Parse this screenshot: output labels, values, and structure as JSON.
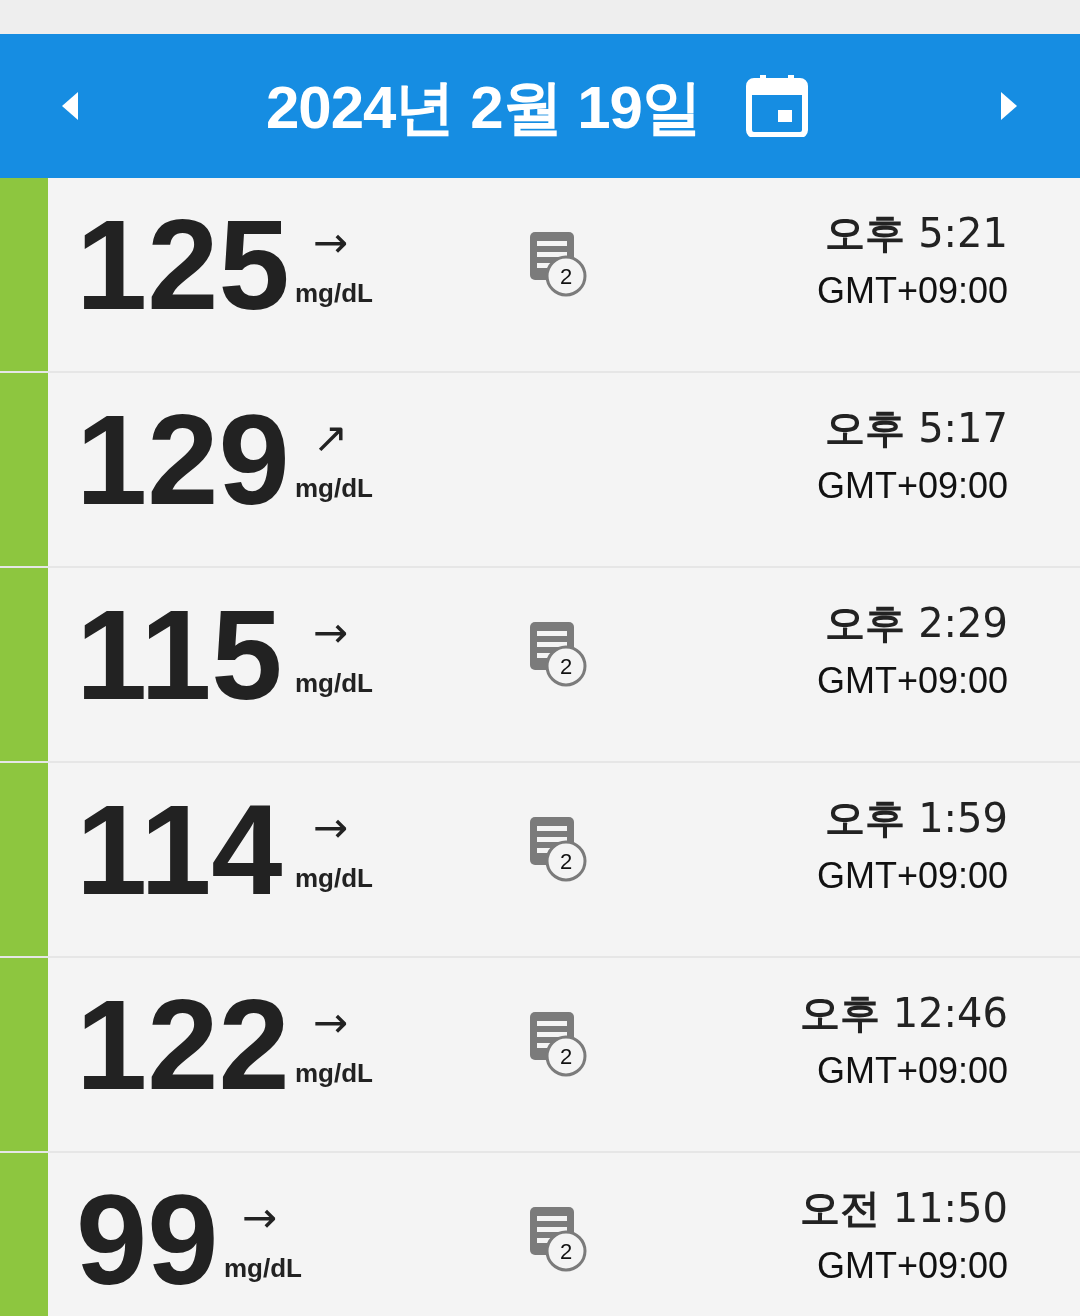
{
  "header": {
    "date": "2024년 2월 19일"
  },
  "readings": [
    {
      "value": "125",
      "unit": "mg/dL",
      "trend": "→",
      "color": "#8dc63f",
      "notes": "2",
      "period": "오후",
      "time": "5:21",
      "zone": "GMT+09:00"
    },
    {
      "value": "129",
      "unit": "mg/dL",
      "trend": "↗",
      "color": "#8dc63f",
      "period": "오후",
      "time": "5:17",
      "zone": "GMT+09:00"
    },
    {
      "value": "115",
      "unit": "mg/dL",
      "trend": "→",
      "color": "#8dc63f",
      "notes": "2",
      "period": "오후",
      "time": "2:29",
      "zone": "GMT+09:00"
    },
    {
      "value": "114",
      "unit": "mg/dL",
      "trend": "→",
      "color": "#8dc63f",
      "notes": "2",
      "period": "오후",
      "time": "1:59",
      "zone": "GMT+09:00"
    },
    {
      "value": "122",
      "unit": "mg/dL",
      "trend": "→",
      "color": "#8dc63f",
      "notes": "2",
      "period": "오후",
      "time": "12:46",
      "zone": "GMT+09:00"
    },
    {
      "value": "99",
      "unit": "mg/dL",
      "trend": "→",
      "color": "#8dc63f",
      "notes": "2",
      "period": "오전",
      "time": "11:50",
      "zone": "GMT+09:00"
    }
  ]
}
